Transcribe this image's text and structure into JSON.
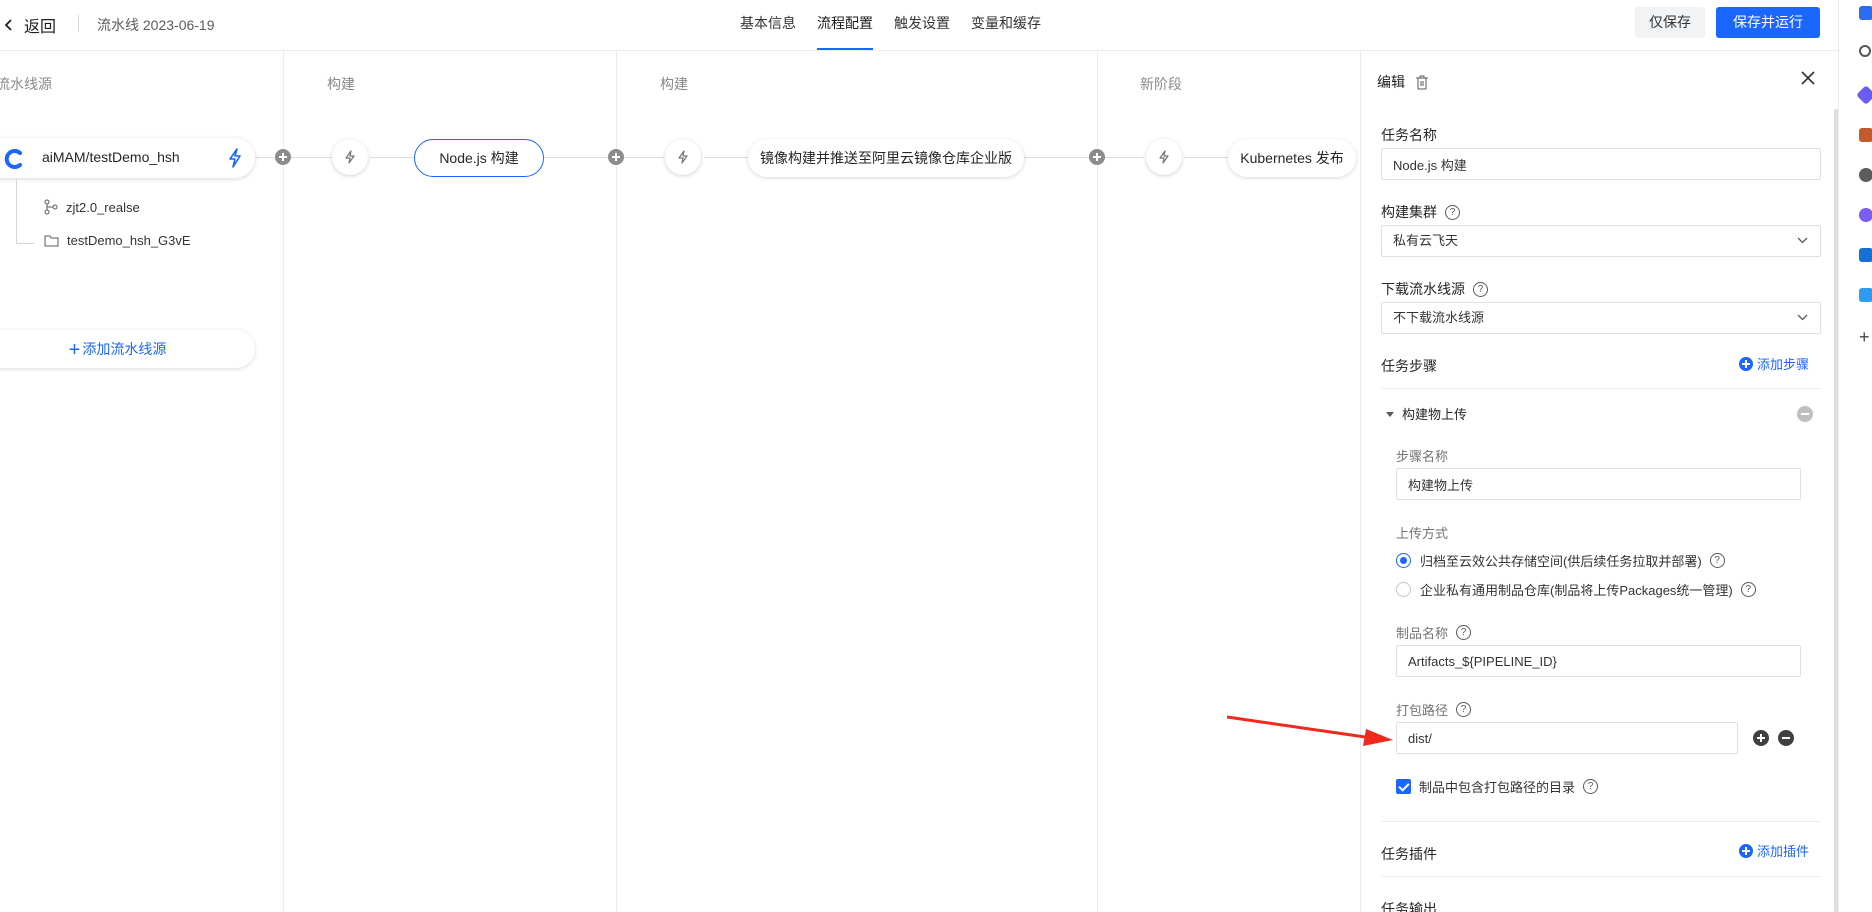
{
  "header": {
    "back_label": "返回",
    "pipeline_title": "流水线 2023-06-19",
    "tabs": [
      {
        "label": "基本信息"
      },
      {
        "label": "流程配置"
      },
      {
        "label": "触发设置"
      },
      {
        "label": "变量和缓存"
      }
    ],
    "save_only_label": "仅保存",
    "save_run_label": "保存并运行"
  },
  "canvas": {
    "stages": [
      {
        "title": "流水线源"
      },
      {
        "title": "构建"
      },
      {
        "title": "构建"
      },
      {
        "title": "新阶段"
      }
    ],
    "source": {
      "repo": "aiMAM/testDemo_hsh",
      "branch": "zjt2.0_realse",
      "folder": "testDemo_hsh_G3vE",
      "add_label": "添加流水线源"
    },
    "tasks": [
      {
        "label": "Node.js 构建"
      },
      {
        "label": "镜像构建并推送至阿里云镜像仓库企业版"
      },
      {
        "label": "Kubernetes 发布"
      }
    ]
  },
  "panel": {
    "title": "编辑",
    "task_name_label": "任务名称",
    "task_name_value": "Node.js 构建",
    "cluster_label": "构建集群",
    "cluster_value": "私有云飞天",
    "download_label": "下载流水线源",
    "download_value": "不下载流水线源",
    "steps_label": "任务步骤",
    "add_step_label": "添加步骤",
    "step": {
      "title": "构建物上传",
      "name_label": "步骤名称",
      "name_value": "构建物上传",
      "upload_label": "上传方式",
      "option_public": "归档至云效公共存储空间(供后续任务拉取并部署)",
      "option_private": "企业私有通用制品仓库(制品将上传Packages统一管理)",
      "artifact_label": "制品名称",
      "artifact_value": "Artifacts_${PIPELINE_ID}",
      "path_label": "打包路径",
      "path_value": "dist/",
      "include_dir_label": "制品中包含打包路径的目录"
    },
    "plugins_label": "任务插件",
    "add_plugin_label": "添加插件",
    "output_label": "任务输出"
  },
  "colors": {
    "primary": "#1b66ff",
    "arrow": "#f0281e"
  }
}
